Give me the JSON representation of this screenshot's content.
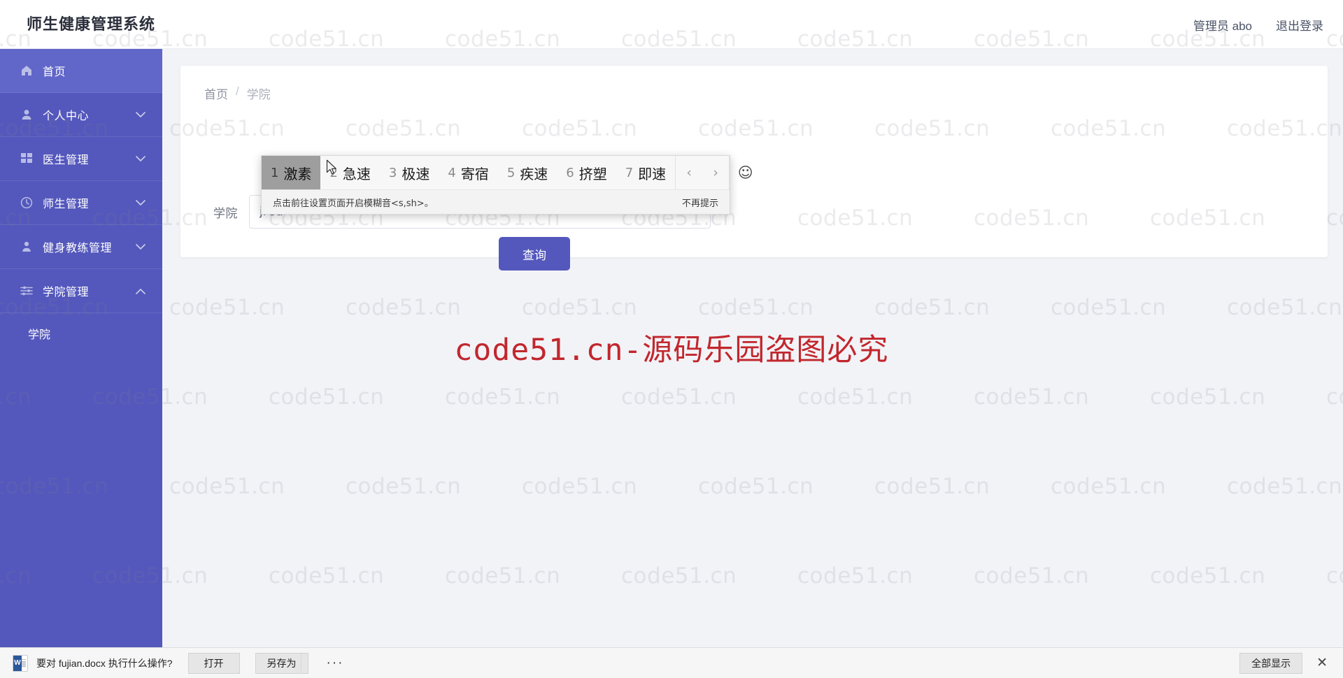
{
  "header": {
    "brand": "师生健康管理系统",
    "user_label": "管理员 abo",
    "logout_label": "退出登录"
  },
  "sidebar": {
    "items": [
      {
        "label": "首页",
        "icon": "home-icon",
        "active": true,
        "arrow": ""
      },
      {
        "label": "个人中心",
        "icon": "user-icon",
        "active": false,
        "arrow": "down"
      },
      {
        "label": "医生管理",
        "icon": "grid-icon",
        "active": false,
        "arrow": "down"
      },
      {
        "label": "师生管理",
        "icon": "clock-icon",
        "active": false,
        "arrow": "down"
      },
      {
        "label": "健身教练管理",
        "icon": "person-icon",
        "active": false,
        "arrow": "down"
      },
      {
        "label": "学院管理",
        "icon": "sliders-icon",
        "active": false,
        "arrow": "up"
      }
    ],
    "sub_items": [
      {
        "label": "学院"
      }
    ]
  },
  "breadcrumb": {
    "home": "首页",
    "separator": "/",
    "current": "学院"
  },
  "form": {
    "label": "学院",
    "input_value": "ji'su",
    "input_placeholder": "",
    "search_button": "查询"
  },
  "ime": {
    "candidates": [
      {
        "num": "1",
        "word": "激素",
        "selected": true
      },
      {
        "num": "2",
        "word": "急速",
        "selected": false
      },
      {
        "num": "3",
        "word": "极速",
        "selected": false
      },
      {
        "num": "4",
        "word": "寄宿",
        "selected": false
      },
      {
        "num": "5",
        "word": "疾速",
        "selected": false
      },
      {
        "num": "6",
        "word": "挤塑",
        "selected": false
      },
      {
        "num": "7",
        "word": "即速",
        "selected": false
      }
    ],
    "prev_icon": "chevron-left-icon",
    "next_icon": "chevron-right-icon",
    "emoji_icon": "smiley-icon",
    "footer_hint": "点击前往设置页面开启模糊音<s,sh>。",
    "footer_dismiss": "不再提示"
  },
  "download_bar": {
    "file_icon": "word-doc-icon",
    "message": "要对 fujian.docx 执行什么操作?",
    "open_label": "打开",
    "saveas_label": "另存为",
    "more_label": "···",
    "showall_label": "全部显示",
    "close_icon": "close-icon"
  },
  "watermark": {
    "tile_text": "code51.cn",
    "center_text": "code51.cn-源码乐园盗图必究",
    "center_color": "#c1272d"
  },
  "colors": {
    "sidebar": "#5458bc",
    "sidebar_active": "#6166c9",
    "primary": "#5458bc",
    "page_bg": "#f2f3f7"
  }
}
